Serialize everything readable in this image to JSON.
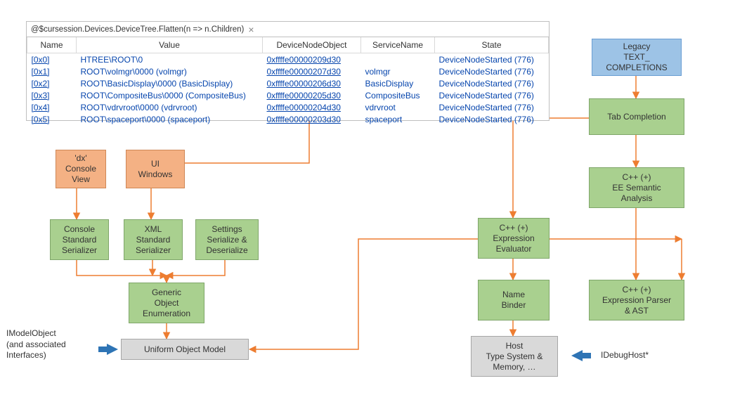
{
  "table": {
    "title": "@$cursession.Devices.DeviceTree.Flatten(n => n.Children)",
    "columns": [
      "Name",
      "Value",
      "DeviceNodeObject",
      "ServiceName",
      "State"
    ],
    "rows": [
      {
        "name": "[0x0]",
        "value": "HTREE\\ROOT\\0",
        "obj": "0xffffe00000209d30",
        "svc": "",
        "state": "DeviceNodeStarted (776)"
      },
      {
        "name": "[0x1]",
        "value": "ROOT\\volmgr\\0000 (volmgr)",
        "obj": "0xffffe00000207d30",
        "svc": "volmgr",
        "state": "DeviceNodeStarted (776)"
      },
      {
        "name": "[0x2]",
        "value": "ROOT\\BasicDisplay\\0000 (BasicDisplay)",
        "obj": "0xffffe00000206d30",
        "svc": "BasicDisplay",
        "state": "DeviceNodeStarted (776)"
      },
      {
        "name": "[0x3]",
        "value": "ROOT\\CompositeBus\\0000 (CompositeBus)",
        "obj": "0xffffe00000205d30",
        "svc": "CompositeBus",
        "state": "DeviceNodeStarted (776)"
      },
      {
        "name": "[0x4]",
        "value": "ROOT\\vdrvroot\\0000 (vdrvroot)",
        "obj": "0xffffe00000204d30",
        "svc": "vdrvroot",
        "state": "DeviceNodeStarted (776)"
      },
      {
        "name": "[0x5]",
        "value": "ROOT\\spaceport\\0000 (spaceport)",
        "obj": "0xffffe00000203d30",
        "svc": "spaceport",
        "state": "DeviceNodeStarted (776)"
      }
    ]
  },
  "boxes": {
    "dx": "'dx'\nConsole\nView",
    "uiwin": "UI\nWindows",
    "css": "Console\nStandard\nSerializer",
    "xss": "XML\nStandard\nSerializer",
    "ssd": "Settings\nSerialize &\nDeserialize",
    "goe": "Generic\nObject\nEnumeration",
    "uom": "Uniform Object Model",
    "legacy": "Legacy\nTEXT_\nCOMPLETIONS",
    "tab": "Tab Completion",
    "eesa": "C++ (+)\nEE Semantic\nAnalysis",
    "cee": "C++ (+)\nExpression\nEvaluator",
    "nb": "Name\nBinder",
    "epast": "C++ (+)\nExpression Parser\n& AST",
    "host": "Host\nType System &\nMemory, …"
  },
  "labels": {
    "imodel": "IModelObject\n(and associated\nInterfaces)",
    "idebughost": "IDebugHost*"
  },
  "colors": {
    "arrow": "#ed7d31",
    "green": "#a9d08f",
    "orange": "#f4b184",
    "blue": "#9dc3e6",
    "gray": "#d9d9d9"
  }
}
